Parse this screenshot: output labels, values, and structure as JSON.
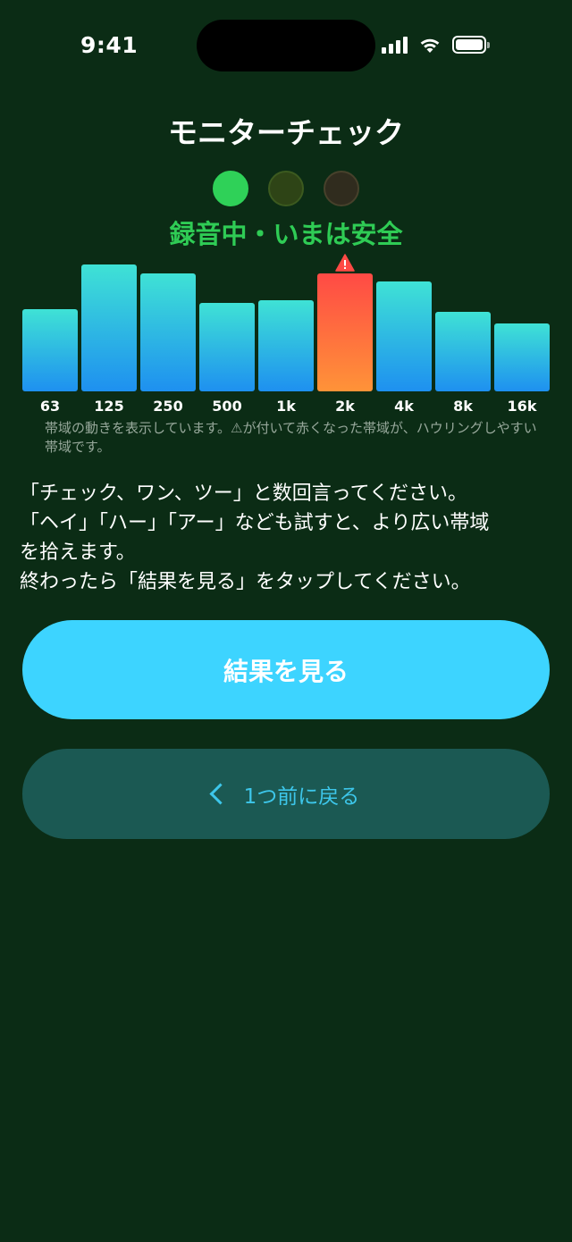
{
  "status_bar": {
    "time": "9:41"
  },
  "header": {
    "title": "モニターチェック"
  },
  "progress_dots": [
    {
      "color": "#2fd158",
      "border": "#2fd158"
    },
    {
      "color": "#2e4416",
      "border": "#3c5a1f"
    },
    {
      "color": "#302c1e",
      "border": "#47412b"
    }
  ],
  "status_text": "録音中・いまは安全",
  "chart_data": {
    "type": "bar",
    "categories": [
      "63",
      "125",
      "250",
      "500",
      "1k",
      "2k",
      "4k",
      "8k",
      "16k"
    ],
    "values": [
      0.64,
      0.99,
      0.92,
      0.69,
      0.71,
      0.92,
      0.86,
      0.62,
      0.53
    ],
    "highlight_index": 5,
    "highlight_icon": "warning-icon",
    "colors": {
      "normal_top": "#3fe2d5",
      "normal_bottom": "#1e90f0",
      "hot_top": "#ff4a45",
      "hot_bottom": "#ff9338"
    }
  },
  "caption": "帯域の動きを表示しています。⚠が付いて赤くなった帯域が、ハウリングしやすい帯域です。",
  "instructions": "「チェック、ワン、ツー」と数回言ってください。\n「ヘイ」「ハー」「アー」なども試すと、より広い帯域\nを拾えます。\n終わったら「結果を見る」をタップしてください。",
  "buttons": {
    "primary_label": "結果を見る",
    "secondary_label": "1つ前に戻る",
    "primary_color": "#3dd4ff",
    "secondary_color": "#1b5953"
  }
}
